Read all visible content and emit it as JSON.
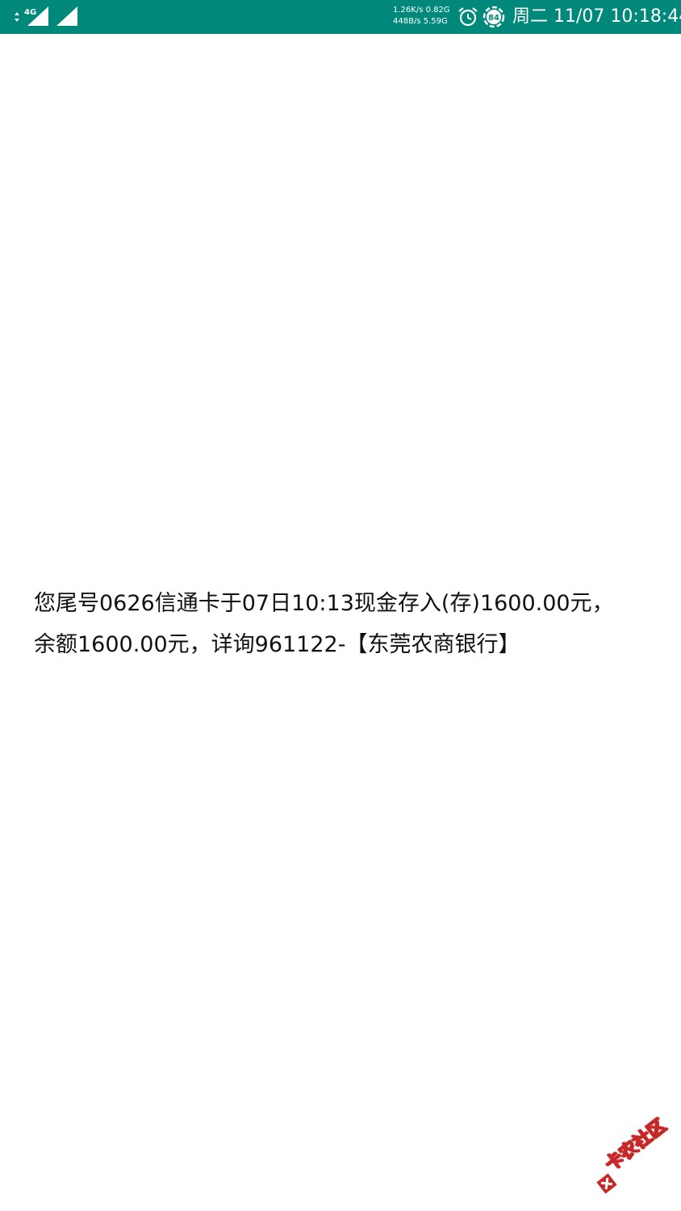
{
  "status_bar": {
    "network_type": "4G",
    "upload_speed": "1.26K/s",
    "upload_total": "0.82G",
    "download_speed": "448B/s",
    "download_total": "5.59G",
    "battery_level": "84",
    "weekday": "周二",
    "datetime": "11/07 10:18:44"
  },
  "message": {
    "line1": "您尾号0626信通卡于07日10:13现金存入(存)1600.00元，",
    "line2": "余额1600.00元，详询961122-【东莞农商银行】"
  },
  "watermark": {
    "text": "卡农社区",
    "color": "#c62828"
  },
  "colors": {
    "status_bar": "#00897b",
    "background": "#ffffff",
    "text": "#111111"
  }
}
